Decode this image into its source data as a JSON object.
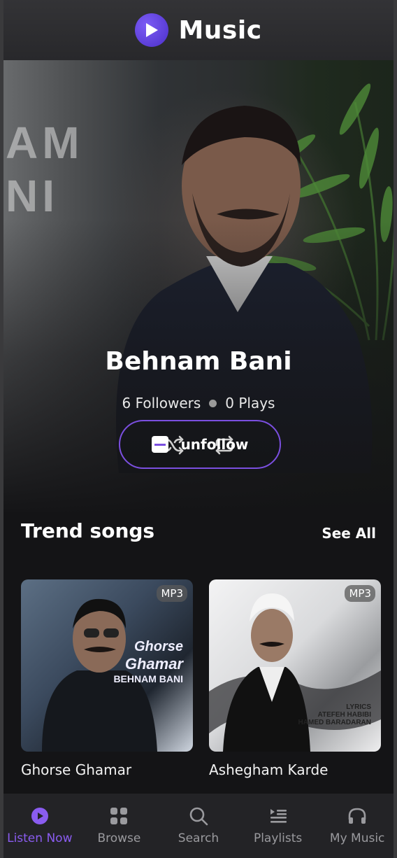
{
  "header": {
    "title": "Music",
    "logo_icon": "play-circle-icon",
    "accent": "#6a48e8"
  },
  "artist": {
    "name": "Behnam Bani",
    "followers": "6 Followers",
    "plays": "0 Plays",
    "background_text_line1": "AM",
    "background_text_line2": "NI"
  },
  "controls": {
    "shuffle_icon": "shuffle-icon",
    "repeat_icon": "repeat-icon"
  },
  "follow_button": {
    "label": "unfollow",
    "icon": "minus-square-icon",
    "border_color": "#7b4fe0"
  },
  "trend": {
    "title": "Trend songs",
    "see_all": "See All",
    "songs": [
      {
        "title": "Ghorse Ghamar",
        "badge": "MP3",
        "cover_text_1": "Ghorse",
        "cover_text_2": "Ghamar",
        "cover_text_3": "BEHNAM BANI"
      },
      {
        "title": "Ashegham Karde",
        "badge": "MP3",
        "cover_text_1": "LYRICS",
        "cover_text_2": "ATEFEH HABIBI",
        "cover_text_3": "HAMED BARADARAN"
      }
    ]
  },
  "nav": {
    "items": [
      {
        "label": "Listen Now",
        "icon": "play-circle-icon",
        "active": true
      },
      {
        "label": "Browse",
        "icon": "grid-icon"
      },
      {
        "label": "Search",
        "icon": "search-icon"
      },
      {
        "label": "Playlists",
        "icon": "playlist-icon"
      },
      {
        "label": "My Music",
        "icon": "headphones-icon"
      }
    ],
    "active_color": "#8a5cf0"
  }
}
